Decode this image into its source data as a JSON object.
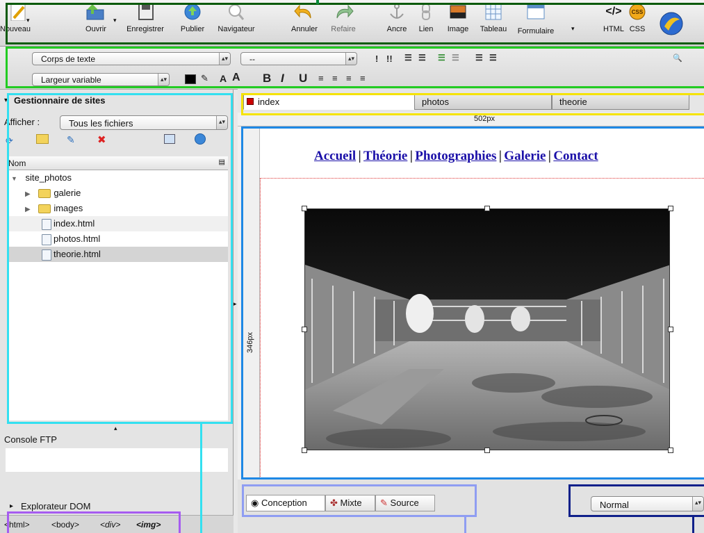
{
  "toolbar": {
    "buttons": [
      {
        "label": "Nouveau"
      },
      {
        "label": "Ouvrir"
      },
      {
        "label": "Enregistrer"
      },
      {
        "label": "Publier"
      },
      {
        "label": "Navigateur"
      },
      {
        "label": "Annuler"
      },
      {
        "label": "Refaire"
      },
      {
        "label": "Ancre"
      },
      {
        "label": "Lien"
      },
      {
        "label": "Image"
      },
      {
        "label": "Tableau"
      },
      {
        "label": "Formulaire"
      },
      {
        "label": "HTML"
      },
      {
        "label": "CSS"
      }
    ]
  },
  "format": {
    "paragraph_style": "Corps de texte",
    "font": "--",
    "width_mode": "Largeur variable"
  },
  "site_manager": {
    "title": "Gestionnaire de sites",
    "show_label": "Afficher :",
    "show_value": "Tous les fichiers",
    "column_name": "Nom",
    "tree": [
      {
        "label": "site_photos",
        "type": "site"
      },
      {
        "label": "galerie",
        "type": "folder"
      },
      {
        "label": "images",
        "type": "folder"
      },
      {
        "label": "index.html",
        "type": "file"
      },
      {
        "label": "photos.html",
        "type": "file"
      },
      {
        "label": "theorie.html",
        "type": "file",
        "selected": true
      }
    ]
  },
  "ftp_console": {
    "title": "Console FTP"
  },
  "dom_explorer": {
    "title": "Explorateur DOM"
  },
  "breadcrumb": [
    "<html>",
    "<body>",
    "<div>",
    "<img>"
  ],
  "document": {
    "tabs": [
      "index",
      "photos",
      "theorie"
    ],
    "width_ruler": "502px",
    "height_ruler": "346px",
    "nav_links": [
      "Accueil",
      "Théorie",
      "Photographies",
      "Galerie",
      "Contact"
    ],
    "nav_separator": "|"
  },
  "view_tabs": [
    "Conception",
    "Mixte",
    "Source"
  ],
  "zoom_select": "Normal",
  "colors": {
    "highlight_green": "#22cc22",
    "highlight_dark_green": "#0a5a0a",
    "highlight_cyan": "#33e0f0",
    "highlight_blue": "#1e88e5",
    "highlight_yellow": "#f5e300",
    "highlight_lavender": "#8f9df2",
    "highlight_purple": "#a65cf0",
    "highlight_navy": "#10208a",
    "link": "#1a0fa8"
  }
}
